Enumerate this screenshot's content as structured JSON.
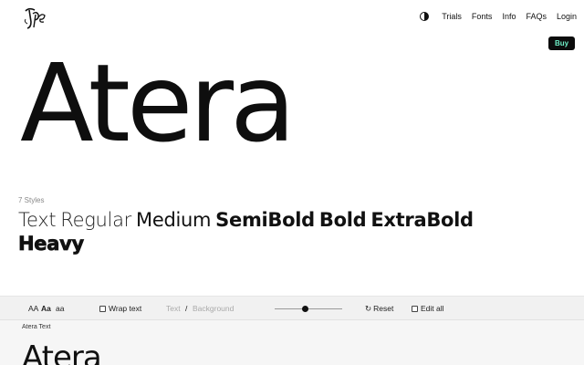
{
  "logo": {
    "icon": "type-monogram-logo"
  },
  "nav": {
    "theme_toggle_icon": "contrast-icon",
    "links": [
      "Trials",
      "Fonts",
      "Info",
      "FAQs",
      "Login"
    ]
  },
  "buy": {
    "label": "Buy",
    "bg_color": "#0c0c0c",
    "text_color": "#6ff0c8"
  },
  "hero": {
    "title": "Atera"
  },
  "styles": {
    "count_label": "7 Styles",
    "weights": [
      "Text",
      "Regular",
      "Medium",
      "SemiBold",
      "Bold",
      "ExtraBold",
      "Heavy"
    ]
  },
  "toolbar": {
    "case_options": [
      "AA",
      "Aa",
      "aa"
    ],
    "case_selected": "Aa",
    "wrap_label": "Wrap text",
    "color_text_label": "Text",
    "color_separator": "/",
    "color_bg_label": "Background",
    "reset_label": "Reset",
    "edit_all_label": "Edit all"
  },
  "preview": {
    "label": "Atera Text",
    "sample": "Atera"
  }
}
